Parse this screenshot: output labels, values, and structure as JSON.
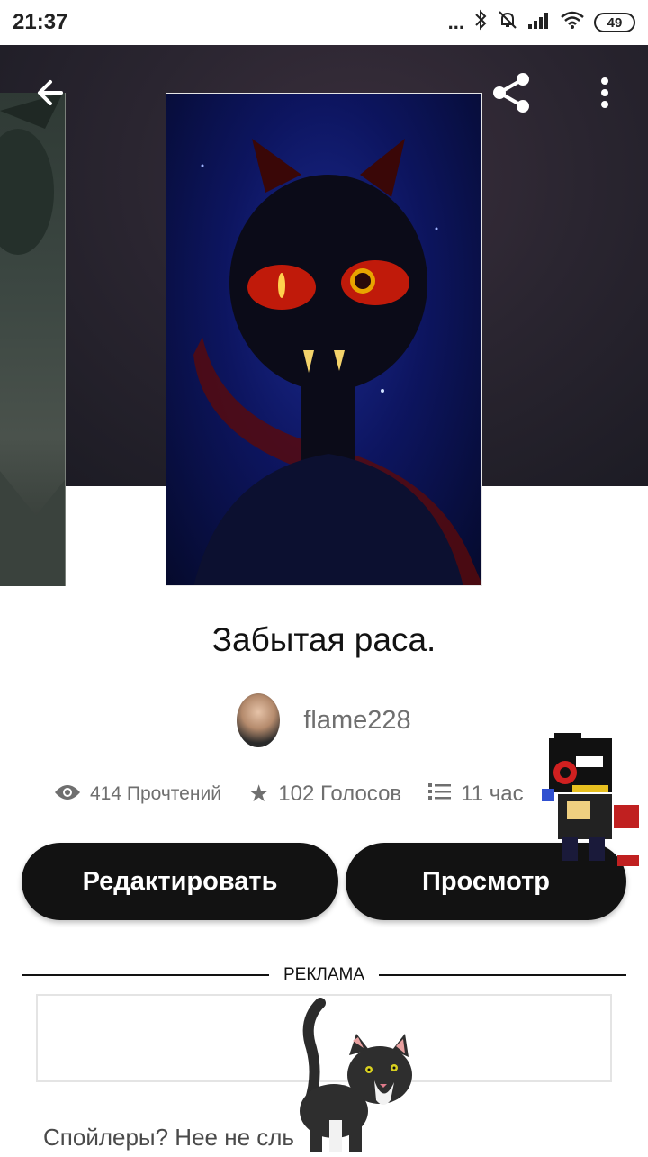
{
  "status_bar": {
    "time": "21:37",
    "signal_dots": "...",
    "battery": "49"
  },
  "header": {
    "back_icon": "arrow-left-icon",
    "share_icon": "share-icon",
    "more_icon": "more-vertical-icon"
  },
  "story": {
    "title": "Забытая раса.",
    "author": "flame228",
    "stats": {
      "reads": "414 Прочтений",
      "votes": "102 Голосов",
      "parts": "11 час"
    }
  },
  "actions": {
    "edit_label": "Редактировать",
    "view_label": "Просмотр"
  },
  "ad": {
    "label": "РЕКЛАМА"
  },
  "description": {
    "text": "Спойлеры? Нее не сль"
  }
}
